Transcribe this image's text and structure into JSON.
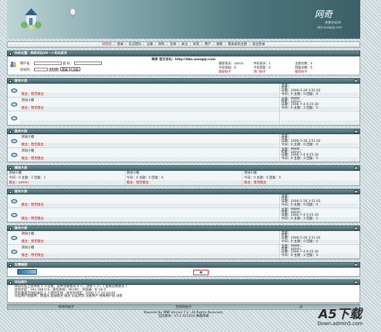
{
  "banner": {
    "logo": "网奇",
    "sub": "免费论坛V8",
    "url": "bbs.wangqi.com"
  },
  "nav": [
    {
      "label": "状态栏",
      "active": true
    },
    {
      "label": "登录"
    },
    {
      "label": "忘记密码"
    },
    {
      "label": "注册"
    },
    {
      "label": "资料"
    },
    {
      "label": "在线"
    },
    {
      "label": "关注"
    },
    {
      "label": "好友"
    },
    {
      "label": "用户"
    },
    {
      "label": "搜索"
    },
    {
      "label": "我发表的主题"
    },
    {
      "label": "退出登录"
    }
  ],
  "location": "你的位置：网奇论坛V8 -->论坛首页",
  "login": {
    "title": "网奇 官方论坛：http://bbs.wangqi.com",
    "username_label": "用户名：",
    "password_label": "密 码：",
    "verify_label": "验证码：",
    "code": "2528",
    "login_btn": "登录",
    "register_btn": "注册"
  },
  "stats": {
    "row1": [
      "最新会员：admin",
      "共有会员：1",
      "主题总数：4"
    ],
    "row2": [
      "今日发贴：0",
      "今日回复：0",
      "回复总数：6"
    ],
    "row3": [
      "最新帖子",
      "热门帖子",
      "推荐帖子"
    ]
  },
  "sections": [
    {
      "title": "版块大类",
      "forums": [
        {
          "name": "",
          "mod": "版主：暂无版主",
          "topic": [
            "主题：",
            "作者：",
            "日期：2006-5-28 3:51:02"
          ],
          "count": "今日：0  主题：0  回复：0"
        },
        {
          "name": "测试小版",
          "mod": "版主：暂无版主",
          "topic": [
            "主题：ffffffff...",
            "作者：admin",
            "日期：2006-7-4 9:25:30"
          ],
          "count": "今日：0  主题：2  回复：5"
        },
        {
          "name": "",
          "mod": "",
          "topic": [],
          "count": ""
        }
      ]
    },
    {
      "title": "版块大类",
      "forums": [
        {
          "name": "测试小版",
          "mod": "版主：暂无版主",
          "topic": [
            "主题：",
            "作者：",
            "日期：2006-5-28 3:51:02"
          ],
          "count": "今日：0  主题：0  回复：0"
        },
        {
          "name": "测试小版",
          "mod": "版主：暂无版主",
          "topic": [
            "主题：ffffffff...",
            "作者：admin",
            "日期：2006-7-4 9:25:30"
          ],
          "count": "今日：0  主题：2  回复：5"
        }
      ]
    },
    {
      "title": "横排大类",
      "grid": [
        [
          "测试小版",
          "今日：0  主题：2  回复：1",
          "版主：admin"
        ],
        [
          "测试小版",
          "今日：0  主题：0  回复：0",
          "版主：暂无版主"
        ],
        [
          "测试小版",
          "今日：0  主题：0  回复：0",
          "版主：暂无版主"
        ]
      ]
    },
    {
      "title": "版块大类",
      "forums": [
        {
          "name": "",
          "mod": "版主：暂无版主",
          "topic": [
            "主题：",
            "作者：",
            "日期：2006-5-28 3:51:02"
          ],
          "count": "今日：0  主题：0  回复：0"
        },
        {
          "name": "",
          "mod": "版主：暂无版主",
          "topic": [
            "主题：ffffffff...",
            "作者：admin",
            "日期：2006-7-4 9:25:30"
          ],
          "count": "今日：0  主题：2  回复：5"
        }
      ]
    },
    {
      "title": "版块大类",
      "forums": [
        {
          "name": "测试小版",
          "mod": "版主：暂无版主",
          "topic": [
            "主题：",
            "作者：",
            "日期：2006-5-28 3:51:02"
          ],
          "count": "今日：0  主题：0  回复：0"
        },
        {
          "name": "测试小版",
          "mod": "版主：暂无版主",
          "topic": [
            "主题：ffffffff...",
            "作者：admin",
            "日期：2006-7-4 9:25:30"
          ],
          "count": "今日：0  主题：2  回复：5"
        }
      ]
    }
  ],
  "links_title": "友情链接",
  "online_title": "论坛统计",
  "online_lines": [
    "目前论坛上总共有 1 人在线，其中注册会员 0 人，访客 1 人。[ 查看在线会员 ]",
    "您的IP是：192.168.0.9，操作系统：WinNT，浏览器：IE V6.0",
    "历史最高在线纪录是 2 人同时在线，发生时间是：2006-7-7 14:54:04",
    "论坛用户组图例：管理员  超级版主  版主  论坛贵宾  注册用户  特殊用户组  访客"
  ],
  "legend": [
    "有新的帖子",
    "无新的帖子",
    "过"
  ],
  "footer": [
    "Powered By 网奇 Version 7.2 , All Rights Reserved.",
    "当前版本：V7.2 ACCESS 数据库版"
  ],
  "watermark": {
    "big": "A5下载",
    "small": "Down.admin5.com"
  }
}
